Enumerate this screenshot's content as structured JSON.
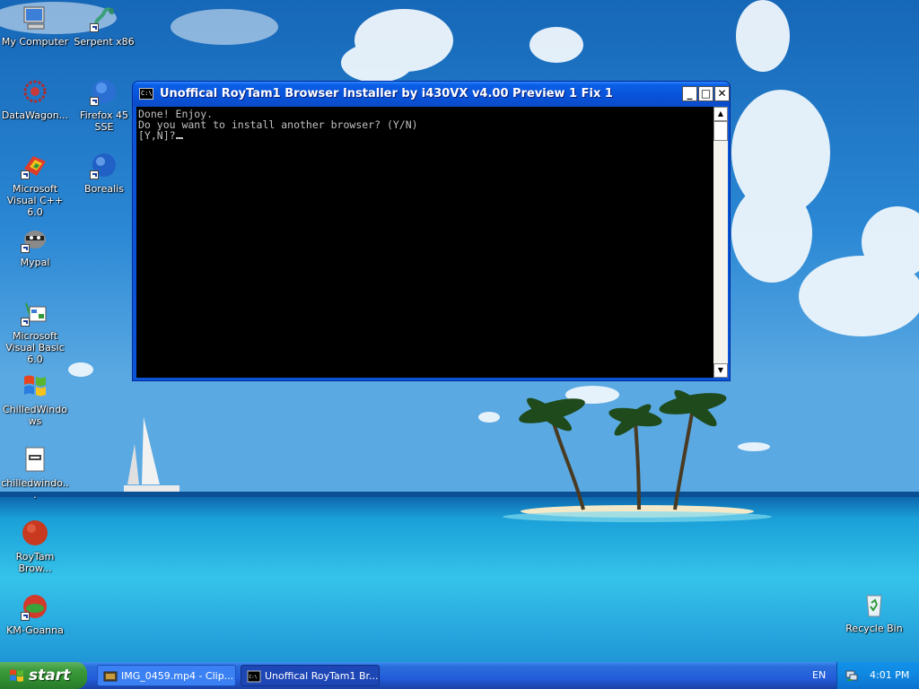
{
  "desktop": {
    "icons": [
      {
        "label": "My Computer",
        "icon": "my-computer-icon"
      },
      {
        "label": "Serpent x86",
        "icon": "serpent-icon"
      },
      {
        "label": "DataWagon...",
        "icon": "datawagon-icon"
      },
      {
        "label": "Firefox 45 SSE",
        "icon": "firefox-icon"
      },
      {
        "label": "Microsoft Visual C++ 6.0",
        "icon": "visual-cpp-icon"
      },
      {
        "label": "Borealis",
        "icon": "borealis-icon"
      },
      {
        "label": "Mypal",
        "icon": "mypal-icon"
      },
      {
        "label": "Microsoft Visual Basic 6.0",
        "icon": "visual-basic-icon"
      },
      {
        "label": "ChilledWindows",
        "icon": "windows-logo-icon"
      },
      {
        "label": "chilledwindo...",
        "icon": "text-file-icon"
      },
      {
        "label": "RoyTam Brow...",
        "icon": "roytam-browser-icon"
      },
      {
        "label": "KM-Goanna",
        "icon": "km-goanna-icon"
      },
      {
        "label": "Recycle Bin",
        "icon": "recycle-bin-icon"
      }
    ]
  },
  "console_window": {
    "title": "Unoffical RoyTam1 Browser Installer by i430VX v4.00 Preview 1 Fix 1",
    "icon_text": "C:\\",
    "minimize_glyph": "_",
    "maximize_glyph": "□",
    "close_glyph": "✕",
    "lines": [
      "Done! Enjoy.",
      "Do you want to install another browser? (Y/N)",
      "[Y,N]?"
    ]
  },
  "taskbar": {
    "start_label": "start",
    "tasks": [
      {
        "label": "IMG_0459.mp4 - Clip...",
        "icon": "clip-player-icon"
      },
      {
        "label": "Unoffical RoyTam1 Br...",
        "icon": "console-icon"
      }
    ],
    "language": "EN",
    "clock": "4:01 PM"
  },
  "colors": {
    "title_bar": "#0a5fe6",
    "console_bg": "#000000",
    "console_text": "#c0c0c0",
    "start_green": "#3c9a3c",
    "taskbar_blue": "#245ddb",
    "tray_blue": "#0f8ae3"
  }
}
